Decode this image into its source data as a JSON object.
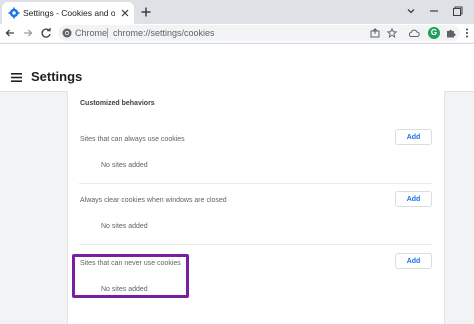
{
  "tab": {
    "title": "Settings - Cookies and other site",
    "favicon": "gear-icon"
  },
  "omnibox": {
    "site_label": "Chrome",
    "url": "chrome://settings/cookies"
  },
  "avatar_letter": "G",
  "header": {
    "title": "Settings"
  },
  "content": {
    "section_title": "Customized behaviors",
    "rows": [
      {
        "label": "Sites that can always use cookies",
        "empty": "No sites added",
        "button": "Add"
      },
      {
        "label": "Always clear cookies when windows are closed",
        "empty": "No sites added",
        "button": "Add"
      },
      {
        "label": "Sites that can never use cookies",
        "empty": "No sites added",
        "button": "Add"
      }
    ]
  },
  "colors": {
    "accent": "#1a73e8",
    "highlight": "#7a1fa2"
  }
}
